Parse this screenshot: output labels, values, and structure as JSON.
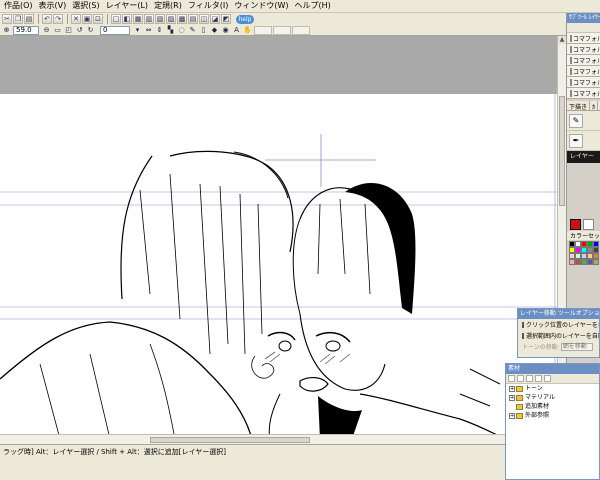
{
  "menubar": {
    "items": [
      "作品(O)",
      "表示(V)",
      "選択(S)",
      "レイヤー(L)",
      "定規(R)",
      "フィルタ(I)",
      "ウィンドウ(W)",
      "ヘルプ(H)"
    ]
  },
  "toolbar1": {
    "help_badge": "help"
  },
  "toolbar2": {
    "zoom_value": "59.0",
    "angle_value": "0"
  },
  "right_panel": {
    "layer_header": "ｻﾌﾞﾂｰﾙ ﾚｲﾔｰ",
    "layers": [
      "コマフォル",
      "コマフォル",
      "コマフォル",
      "コマフォル",
      "コマフォル",
      "コマフォル"
    ],
    "tool_tabs": [
      "下描き",
      "ｶ"
    ],
    "current_layer": "レイヤー",
    "colorset_label": "カラーセット"
  },
  "tool_option": {
    "title": "レイヤー移動 ツールオプション",
    "option1": "クリック位置のレイヤーを自動選択",
    "option2": "選択範囲内のレイヤーを自動選択",
    "tone_label": "トーンの移動",
    "tone_value": "網を移動"
  },
  "material_panel": {
    "title": "素材",
    "tree": [
      "トーン",
      "マテリアル",
      "追加素材",
      "外部参照"
    ]
  },
  "status": {
    "text": "ラッグ時] Alt：レイヤー選択 / Shift + Alt：選択に追加[レイヤー選択]"
  },
  "swatch_colors": [
    "#000000",
    "#ffffff",
    "#ff0000",
    "#00aa00",
    "#0000ff",
    "#ffff00",
    "#ff00ff",
    "#00ffff",
    "#888888",
    "#444444",
    "#ffcccc",
    "#ccffcc",
    "#ccccff",
    "#ffcc88",
    "#cc8844",
    "#ffaaaa",
    "#aa5555",
    "#55aa55",
    "#5555aa",
    "#aaaa55"
  ]
}
